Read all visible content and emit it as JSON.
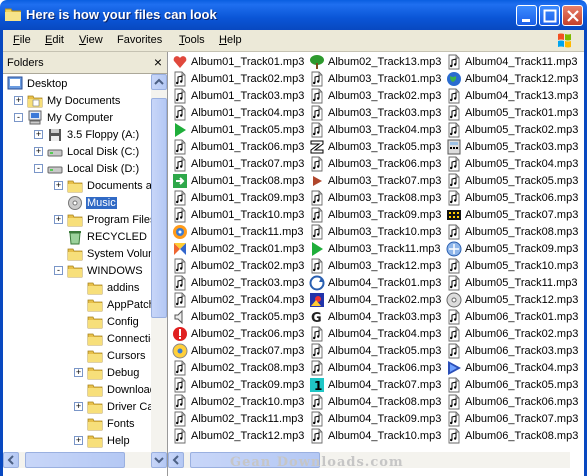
{
  "window": {
    "title": "Here is how your files can look",
    "buttons": [
      "minimize",
      "maximize",
      "close"
    ]
  },
  "menu": [
    {
      "label": "File",
      "u": "F",
      "rest": "ile"
    },
    {
      "label": "Edit",
      "u": "E",
      "rest": "dit"
    },
    {
      "label": "View",
      "u": "V",
      "rest": "iew"
    },
    {
      "label": "Favorites",
      "u": "",
      "rest": "Favorites"
    },
    {
      "label": "Tools",
      "u": "T",
      "rest": "ools"
    },
    {
      "label": "Help",
      "u": "H",
      "rest": "elp"
    }
  ],
  "folders_pane": {
    "title": "Folders",
    "close_glyph": "×",
    "tree": [
      {
        "label": "Desktop",
        "level": 0,
        "icon": "desktop-icon",
        "expander": ""
      },
      {
        "label": "My Documents",
        "level": 1,
        "icon": "my-documents-icon",
        "expander": "+"
      },
      {
        "label": "My Computer",
        "level": 1,
        "icon": "my-computer-icon",
        "expander": "-"
      },
      {
        "label": "3.5 Floppy (A:)",
        "level": 2,
        "icon": "floppy-icon",
        "expander": "+"
      },
      {
        "label": "Local Disk (C:)",
        "level": 2,
        "icon": "disk-icon",
        "expander": "+"
      },
      {
        "label": "Local Disk (D:)",
        "level": 2,
        "icon": "disk-icon",
        "expander": "-"
      },
      {
        "label": "Documents ar",
        "level": 3,
        "icon": "folder-icon",
        "expander": "+"
      },
      {
        "label": "Music",
        "level": 3,
        "icon": "music-folder-icon",
        "expander": "",
        "selected": true
      },
      {
        "label": "Program Files",
        "level": 3,
        "icon": "folder-icon",
        "expander": "+"
      },
      {
        "label": "RECYCLED",
        "level": 3,
        "icon": "recycle-bin-icon",
        "expander": ""
      },
      {
        "label": "System Volum",
        "level": 3,
        "icon": "folder-icon",
        "expander": ""
      },
      {
        "label": "WINDOWS",
        "level": 3,
        "icon": "folder-icon",
        "expander": "-"
      },
      {
        "label": "addins",
        "level": 4,
        "icon": "folder-icon",
        "expander": ""
      },
      {
        "label": "AppPatch",
        "level": 4,
        "icon": "folder-icon",
        "expander": ""
      },
      {
        "label": "Config",
        "level": 4,
        "icon": "folder-icon",
        "expander": ""
      },
      {
        "label": "Connectic",
        "level": 4,
        "icon": "folder-icon",
        "expander": ""
      },
      {
        "label": "Cursors",
        "level": 4,
        "icon": "folder-icon",
        "expander": ""
      },
      {
        "label": "Debug",
        "level": 4,
        "icon": "folder-icon",
        "expander": "+"
      },
      {
        "label": "Download",
        "level": 4,
        "icon": "folder-icon",
        "expander": ""
      },
      {
        "label": "Driver Cac",
        "level": 4,
        "icon": "folder-icon",
        "expander": "+"
      },
      {
        "label": "Fonts",
        "level": 4,
        "icon": "folder-icon",
        "expander": ""
      },
      {
        "label": "Help",
        "level": 4,
        "icon": "folder-icon",
        "expander": "+"
      }
    ]
  },
  "files": [
    {
      "name": "Album01_Track01.mp3",
      "icon": "heart-icon"
    },
    {
      "name": "Album01_Track02.mp3",
      "icon": "audio-file-icon"
    },
    {
      "name": "Album01_Track03.mp3",
      "icon": "audio-file-icon"
    },
    {
      "name": "Album01_Track04.mp3",
      "icon": "audio-file-icon"
    },
    {
      "name": "Album01_Track05.mp3",
      "icon": "green-play-icon"
    },
    {
      "name": "Album01_Track06.mp3",
      "icon": "audio-file-icon"
    },
    {
      "name": "Album01_Track07.mp3",
      "icon": "audio-file-icon"
    },
    {
      "name": "Album01_Track08.mp3",
      "icon": "green-arrow-icon"
    },
    {
      "name": "Album01_Track09.mp3",
      "icon": "audio-file-icon"
    },
    {
      "name": "Album01_Track10.mp3",
      "icon": "audio-file-icon"
    },
    {
      "name": "Album01_Track11.mp3",
      "icon": "disc-icon"
    },
    {
      "name": "Album02_Track01.mp3",
      "icon": "colorful-icon"
    },
    {
      "name": "Album02_Track02.mp3",
      "icon": "audio-file-icon"
    },
    {
      "name": "Album02_Track03.mp3",
      "icon": "audio-file-icon"
    },
    {
      "name": "Album02_Track04.mp3",
      "icon": "audio-file-icon"
    },
    {
      "name": "Album02_Track05.mp3",
      "icon": "speaker-icon"
    },
    {
      "name": "Album02_Track06.mp3",
      "icon": "red-alert-icon"
    },
    {
      "name": "Album02_Track07.mp3",
      "icon": "cd-icon"
    },
    {
      "name": "Album02_Track08.mp3",
      "icon": "audio-file-icon"
    },
    {
      "name": "Album02_Track09.mp3",
      "icon": "audio-file-icon"
    },
    {
      "name": "Album02_Track10.mp3",
      "icon": "audio-file-icon"
    },
    {
      "name": "Album02_Track11.mp3",
      "icon": "audio-file-icon"
    },
    {
      "name": "Album02_Track12.mp3",
      "icon": "audio-file-icon"
    },
    {
      "name": "Album02_Track13.mp3",
      "icon": "tree-icon"
    },
    {
      "name": "Album03_Track01.mp3",
      "icon": "audio-file-icon"
    },
    {
      "name": "Album03_Track02.mp3",
      "icon": "audio-file-icon"
    },
    {
      "name": "Album03_Track03.mp3",
      "icon": "audio-file-icon"
    },
    {
      "name": "Album03_Track04.mp3",
      "icon": "audio-file-icon"
    },
    {
      "name": "Album03_Track05.mp3",
      "icon": "z-letter-icon"
    },
    {
      "name": "Album03_Track06.mp3",
      "icon": "audio-file-icon"
    },
    {
      "name": "Album03_Track07.mp3",
      "icon": "brown-play-icon"
    },
    {
      "name": "Album03_Track08.mp3",
      "icon": "audio-file-icon"
    },
    {
      "name": "Album03_Track09.mp3",
      "icon": "audio-file-icon"
    },
    {
      "name": "Album03_Track10.mp3",
      "icon": "audio-file-icon"
    },
    {
      "name": "Album03_Track11.mp3",
      "icon": "green-play-icon"
    },
    {
      "name": "Album03_Track12.mp3",
      "icon": "audio-file-icon"
    },
    {
      "name": "Album04_Track01.mp3",
      "icon": "sync-icon"
    },
    {
      "name": "Album04_Track02.mp3",
      "icon": "blue-picture-icon"
    },
    {
      "name": "Album04_Track03.mp3",
      "icon": "g-letter-icon"
    },
    {
      "name": "Album04_Track04.mp3",
      "icon": "audio-file-icon"
    },
    {
      "name": "Album04_Track05.mp3",
      "icon": "audio-file-icon"
    },
    {
      "name": "Album04_Track06.mp3",
      "icon": "audio-file-icon"
    },
    {
      "name": "Album04_Track07.mp3",
      "icon": "cyan-one-icon"
    },
    {
      "name": "Album04_Track08.mp3",
      "icon": "audio-file-icon"
    },
    {
      "name": "Album04_Track09.mp3",
      "icon": "audio-file-icon"
    },
    {
      "name": "Album04_Track10.mp3",
      "icon": "audio-file-icon"
    },
    {
      "name": "Album04_Track11.mp3",
      "icon": "audio-file-icon"
    },
    {
      "name": "Album04_Track12.mp3",
      "icon": "globe-icon"
    },
    {
      "name": "Album04_Track13.mp3",
      "icon": "audio-file-icon"
    },
    {
      "name": "Album05_Track01.mp3",
      "icon": "audio-file-icon"
    },
    {
      "name": "Album05_Track02.mp3",
      "icon": "audio-file-icon"
    },
    {
      "name": "Album05_Track03.mp3",
      "icon": "calculator-icon"
    },
    {
      "name": "Album05_Track04.mp3",
      "icon": "audio-file-icon"
    },
    {
      "name": "Album05_Track05.mp3",
      "icon": "audio-file-icon"
    },
    {
      "name": "Album05_Track06.mp3",
      "icon": "audio-file-icon"
    },
    {
      "name": "Album05_Track07.mp3",
      "icon": "film-icon"
    },
    {
      "name": "Album05_Track08.mp3",
      "icon": "audio-file-icon"
    },
    {
      "name": "Album05_Track09.mp3",
      "icon": "network-icon"
    },
    {
      "name": "Album05_Track10.mp3",
      "icon": "audio-file-icon"
    },
    {
      "name": "Album05_Track11.mp3",
      "icon": "audio-file-icon"
    },
    {
      "name": "Album05_Track12.mp3",
      "icon": "cd-disc-icon"
    },
    {
      "name": "Album06_Track01.mp3",
      "icon": "audio-file-icon"
    },
    {
      "name": "Album06_Track02.mp3",
      "icon": "audio-file-icon"
    },
    {
      "name": "Album06_Track03.mp3",
      "icon": "audio-file-icon"
    },
    {
      "name": "Album06_Track04.mp3",
      "icon": "media-player-icon"
    },
    {
      "name": "Album06_Track05.mp3",
      "icon": "audio-file-icon"
    },
    {
      "name": "Album06_Track06.mp3",
      "icon": "audio-file-icon"
    },
    {
      "name": "Album06_Track07.mp3",
      "icon": "audio-file-icon"
    },
    {
      "name": "Album06_Track08.mp3",
      "icon": "audio-file-icon"
    }
  ],
  "watermark": "Gean Downloads.com",
  "colors": {
    "titlebar": "#0a55d6",
    "selection": "#316ac5",
    "menubar": "#ece9d8",
    "folder": "#f3d35a"
  }
}
